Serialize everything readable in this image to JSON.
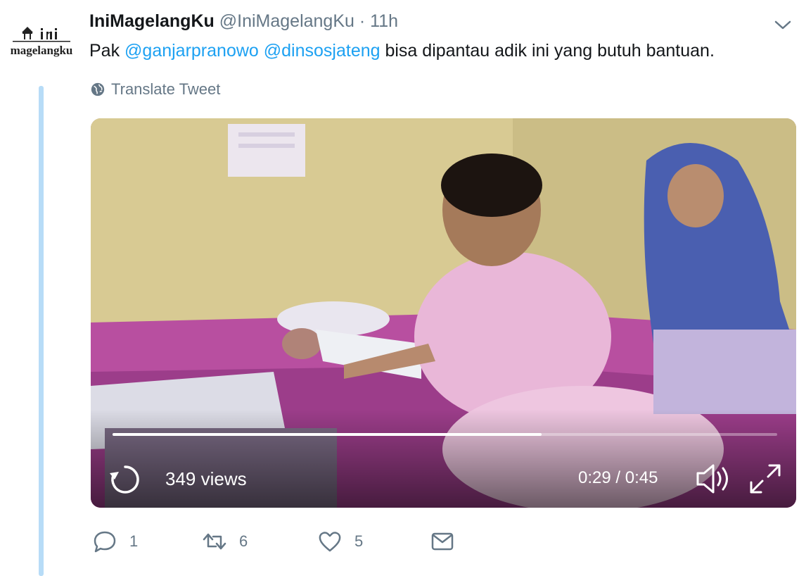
{
  "tweet": {
    "display_name": "IniMagelangKu",
    "handle": "@IniMagelangKu",
    "separator": "·",
    "time": "11h",
    "avatar_text": "magelangku",
    "text_parts": [
      {
        "type": "text",
        "value": "Pak "
      },
      {
        "type": "mention",
        "value": "@ganjarpranowo"
      },
      {
        "type": "text",
        "value": " "
      },
      {
        "type": "mention",
        "value": "@dinsosjateng"
      },
      {
        "type": "text",
        "value": " bisa dipantau adik ini yang butuh bantuan."
      }
    ],
    "translate_label": "Translate Tweet"
  },
  "video": {
    "views": "349 views",
    "timecode": "0:29 / 0:45",
    "progress_fraction": 0.645
  },
  "actions": {
    "reply_count": "1",
    "retweet_count": "6",
    "like_count": "5"
  },
  "colors": {
    "link": "#1da1f2",
    "secondary_text": "#657786",
    "thread_line": "#b7dcf7"
  }
}
